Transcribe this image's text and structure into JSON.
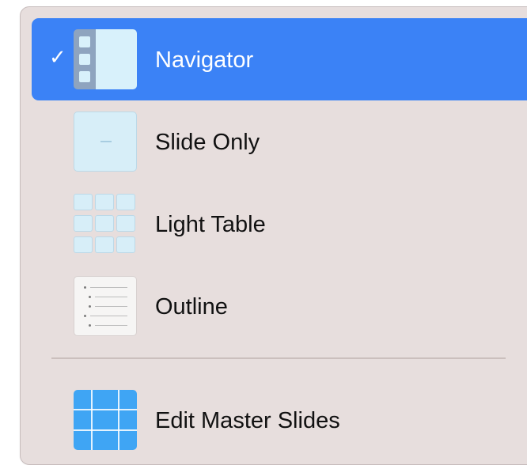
{
  "menu": {
    "items": [
      {
        "label": "Navigator",
        "selected": true,
        "checkmark": "✓",
        "icon": "navigator-view-icon"
      },
      {
        "label": "Slide Only",
        "selected": false,
        "icon": "slide-only-view-icon"
      },
      {
        "label": "Light Table",
        "selected": false,
        "icon": "light-table-view-icon"
      },
      {
        "label": "Outline",
        "selected": false,
        "icon": "outline-view-icon"
      },
      {
        "label": "Edit Master Slides",
        "selected": false,
        "icon": "edit-master-slides-icon"
      }
    ]
  },
  "colors": {
    "menu_background": "#e7dedd",
    "selected_background": "#3b82f6",
    "selected_text": "#ffffff",
    "text": "#111111",
    "divider": "#cbbfbd"
  }
}
